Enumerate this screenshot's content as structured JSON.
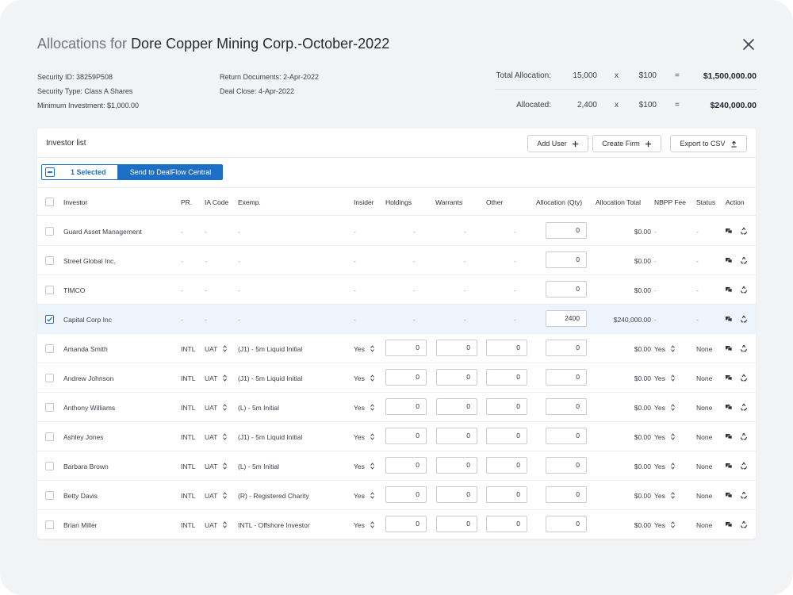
{
  "header": {
    "title_lead": "Allocations for ",
    "title_name": "Dore Copper Mining Corp.-October-2022"
  },
  "details": {
    "security_id": "Security ID: 38259P508",
    "security_type": "Security Type: Class A Shares",
    "minimum_investment": "Minimum Investment: $1,000.00",
    "return_documents": "Return Documents: 2-Apr-2022",
    "deal_close": "Deal Close: 4-Apr-2022"
  },
  "totals": [
    {
      "label": "Total Allocation:",
      "qty": "15,000",
      "x": "x",
      "price": "$100",
      "eq": "=",
      "total": "$1,500,000.00"
    },
    {
      "label": "Allocated:",
      "qty": "2,400",
      "x": "x",
      "price": "$100",
      "eq": "=",
      "total": "$240,000.00"
    }
  ],
  "card": {
    "title": "Investor list",
    "add_user": "Add User",
    "create_firm": "Create Firm",
    "export_csv": "Export to CSV",
    "selected_count": "1 Selected",
    "send_button": "Send to DealFlow Central"
  },
  "columns": [
    "Investor",
    "PR.",
    "IA Code",
    "Exemp.",
    "Insider",
    "Holdings",
    "Warrants",
    "Other",
    "Allocation (Qty)",
    "Allocation Total",
    "NBPP Fee",
    "Status",
    "Action"
  ],
  "rows": [
    {
      "name": "Guard Asset Management",
      "pr": "-",
      "ia": "-",
      "exemp": "-",
      "insider": "-",
      "holdings": "-",
      "warrants": "-",
      "other": "-",
      "qty": "0",
      "total": "$0.00",
      "nbpp": "-",
      "status": "-",
      "checked": false,
      "editable": false
    },
    {
      "name": "Street Global Inc.",
      "pr": "-",
      "ia": "-",
      "exemp": "-",
      "insider": "-",
      "holdings": "-",
      "warrants": "-",
      "other": "-",
      "qty": "0",
      "total": "$0.00",
      "nbpp": "-",
      "status": "-",
      "checked": false,
      "editable": false
    },
    {
      "name": "TIMCO",
      "pr": "-",
      "ia": "-",
      "exemp": "-",
      "insider": "-",
      "holdings": "-",
      "warrants": "-",
      "other": "-",
      "qty": "0",
      "total": "$0.00",
      "nbpp": "-",
      "status": "-",
      "checked": false,
      "editable": false
    },
    {
      "name": "Capital Corp Inc",
      "pr": "-",
      "ia": "-",
      "exemp": "-",
      "insider": "-",
      "holdings": "-",
      "warrants": "-",
      "other": "-",
      "qty": "2400",
      "total": "$240,000.00",
      "nbpp": "-",
      "status": "-",
      "checked": true,
      "editable": false
    },
    {
      "name": "Amanda Smith",
      "pr": "INTL",
      "ia": "UAT",
      "exemp": "(J1) - 5m Liquid Initial",
      "insider": "Yes",
      "holdings": "0",
      "warrants": "0",
      "other": "0",
      "qty": "0",
      "total": "$0.00",
      "nbpp": "Yes",
      "status": "None",
      "checked": false,
      "editable": true
    },
    {
      "name": "Andrew Johnson",
      "pr": "INTL",
      "ia": "UAT",
      "exemp": "(J1) - 5m Liquid Initial",
      "insider": "Yes",
      "holdings": "0",
      "warrants": "0",
      "other": "0",
      "qty": "0",
      "total": "$0.00",
      "nbpp": "Yes",
      "status": "None",
      "checked": false,
      "editable": true
    },
    {
      "name": "Anthony Williams",
      "pr": "INTL",
      "ia": "UAT",
      "exemp": "(L) - 5m Initial",
      "insider": "Yes",
      "holdings": "0",
      "warrants": "0",
      "other": "0",
      "qty": "0",
      "total": "$0.00",
      "nbpp": "Yes",
      "status": "None",
      "checked": false,
      "editable": true
    },
    {
      "name": "Ashley Jones",
      "pr": "INTL",
      "ia": "UAT",
      "exemp": "(J1) - 5m Liquid Initial",
      "insider": "Yes",
      "holdings": "0",
      "warrants": "0",
      "other": "0",
      "qty": "0",
      "total": "$0.00",
      "nbpp": "Yes",
      "status": "None",
      "checked": false,
      "editable": true
    },
    {
      "name": "Barbara Brown",
      "pr": "INTL",
      "ia": "UAT",
      "exemp": "(L) - 5m Initial",
      "insider": "Yes",
      "holdings": "0",
      "warrants": "0",
      "other": "0",
      "qty": "0",
      "total": "$0.00",
      "nbpp": "Yes",
      "status": "None",
      "checked": false,
      "editable": true
    },
    {
      "name": "Betty Davis",
      "pr": "INTL",
      "ia": "UAT",
      "exemp": "(R) - Registered Charity",
      "insider": "Yes",
      "holdings": "0",
      "warrants": "0",
      "other": "0",
      "qty": "0",
      "total": "$0.00",
      "nbpp": "Yes",
      "status": "None",
      "checked": false,
      "editable": true
    },
    {
      "name": "Brian Miller",
      "pr": "INTL",
      "ia": "UAT",
      "exemp": "INTL - Offshore Investor",
      "insider": "Yes",
      "holdings": "0",
      "warrants": "0",
      "other": "0",
      "qty": "0",
      "total": "$0.00",
      "nbpp": "Yes",
      "status": "None",
      "checked": false,
      "editable": true
    }
  ],
  "icons": {
    "close": "close-icon",
    "add": "plus-icon",
    "export": "upload-icon",
    "action_1": "chat-icon",
    "action_2": "recycle-icon"
  },
  "colors": {
    "accent": "#1c6fc5",
    "selected_row": "#eef4fb",
    "background": "#f2f3f5"
  }
}
